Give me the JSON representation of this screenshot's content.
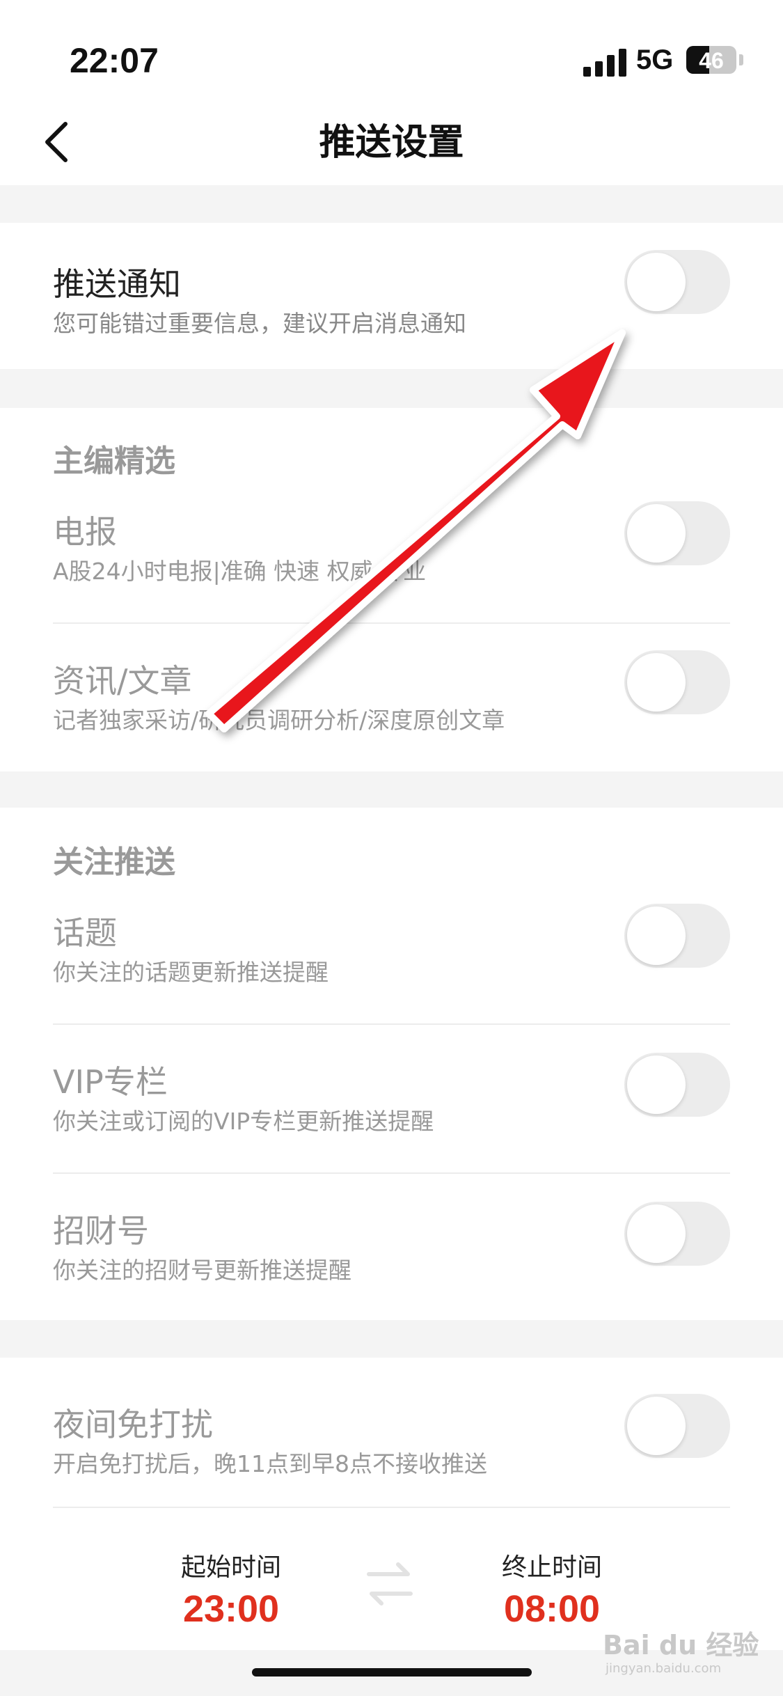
{
  "status_bar": {
    "time": "22:07",
    "network": "5G",
    "battery": "46",
    "battery_level": 0.46,
    "signal_icon": "signal-bars-icon"
  },
  "nav": {
    "title": "推送设置",
    "back_icon": "chevron-left-icon"
  },
  "push_notification": {
    "title": "推送通知",
    "subtitle": "您可能错过重要信息，建议开启消息通知",
    "enabled": false
  },
  "editor_picks": {
    "header": "主编精选",
    "items": [
      {
        "title": "电报",
        "subtitle": "A股24小时电报|准确 快速 权威 专业",
        "enabled": false
      },
      {
        "title": "资讯/文章",
        "subtitle": "记者独家采访/研究员调研分析/深度原创文章",
        "enabled": false
      }
    ]
  },
  "follow_push": {
    "header": "关注推送",
    "items": [
      {
        "title": "话题",
        "subtitle": "你关注的话题更新推送提醒",
        "enabled": false
      },
      {
        "title": "VIP专栏",
        "subtitle": "你关注或订阅的VIP专栏更新推送提醒",
        "enabled": false
      },
      {
        "title": "招财号",
        "subtitle": "你关注的招财号更新推送提醒",
        "enabled": false
      }
    ]
  },
  "do_not_disturb": {
    "title": "夜间免打扰",
    "subtitle": "开启免打扰后，晚11点到早8点不接收推送",
    "enabled": false,
    "start_label": "起始时间",
    "start_time": "23:00",
    "end_label": "终止时间",
    "end_time": "08:00",
    "swap_icon": "swap-arrows-icon"
  },
  "overlay": {
    "arrow_color": "#e8141c",
    "arrow_icon": "red-arrow-annotation"
  },
  "watermark": {
    "brand": "Bai du 经验",
    "url": "jingyan.baidu.com"
  },
  "colors": {
    "accent": "#e0301e",
    "toggle_off": "#ececec",
    "background": "#f4f4f4"
  }
}
